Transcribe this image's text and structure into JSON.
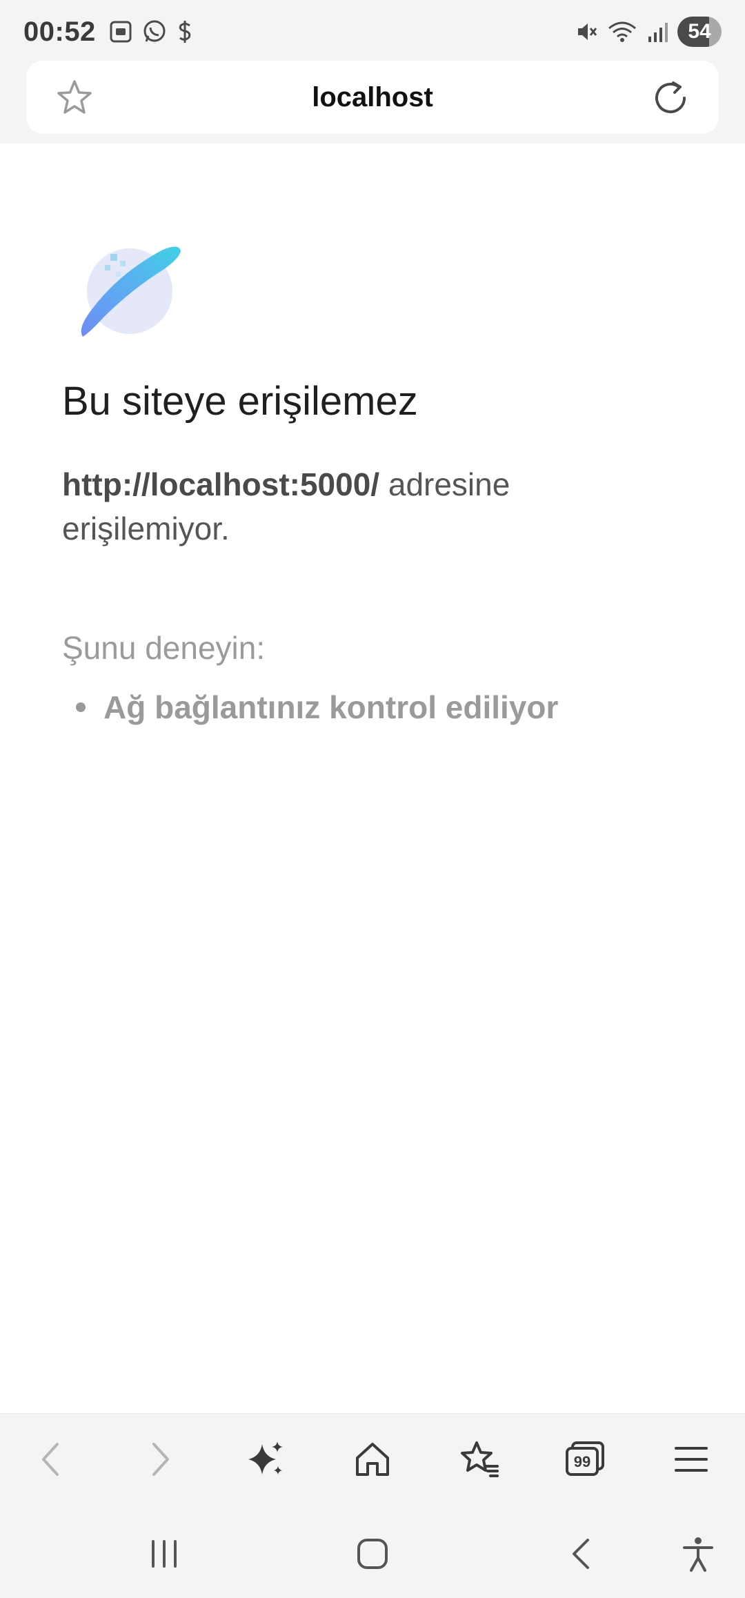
{
  "status_bar": {
    "time": "00:52",
    "battery": "54",
    "left_icons": [
      "screenshot-icon",
      "whatsapp-icon",
      "dollar-icon"
    ],
    "right_icons": [
      "mute-icon",
      "wifi-icon",
      "signal-icon"
    ]
  },
  "url_bar": {
    "title": "localhost"
  },
  "error_page": {
    "title": "Bu siteye erişilemez",
    "url": "http://localhost:5000/",
    "message_suffix": " adresine erişilemiyor.",
    "try_label": "Şunu deneyin:",
    "suggestions": [
      "Ağ bağlantınız kontrol ediliyor"
    ]
  },
  "toolbar": {
    "items": [
      "back-icon",
      "forward-icon",
      "sparkle-icon",
      "home-icon",
      "bookmarks-icon",
      "tabs-icon",
      "menu-icon"
    ],
    "tab_count": "99"
  },
  "nav_bar": {
    "items": [
      "recents-icon",
      "home-circle-icon",
      "nav-back-icon",
      "accessibility-icon"
    ]
  },
  "colors": {
    "chrome_background": "#f4f4f5",
    "title_text": "#1f1f1f",
    "muted_text": "#9a9a9a",
    "globe_accent": "#3fd1e6"
  }
}
